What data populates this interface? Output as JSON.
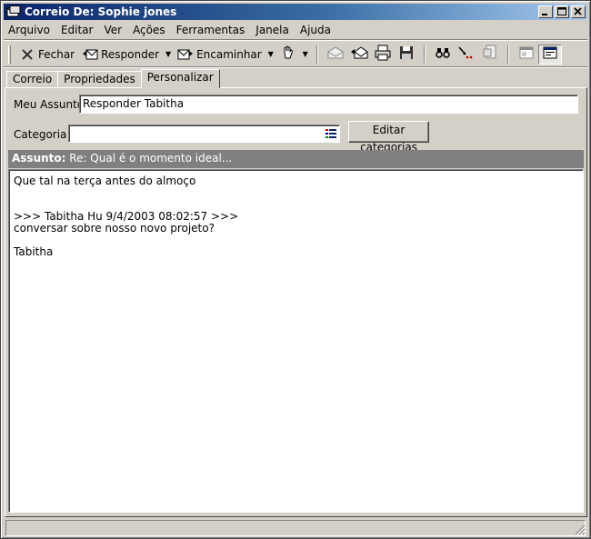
{
  "window": {
    "title": "Correio De: Sophie jones"
  },
  "menu": [
    "Arquivo",
    "Editar",
    "Ver",
    "Ações",
    "Ferramentas",
    "Janela",
    "Ajuda"
  ],
  "toolbar": {
    "close_label": "Fechar",
    "reply_label": "Responder",
    "forward_label": "Encaminhar"
  },
  "tabs": [
    {
      "label": "Correio",
      "active": false
    },
    {
      "label": "Propriedades",
      "active": false
    },
    {
      "label": "Personalizar",
      "active": true
    }
  ],
  "form": {
    "my_subject_label": "Meu Assunto:",
    "my_subject_value": "Responder Tabitha",
    "category_label": "Categoria",
    "category_value": "",
    "edit_categories_label": "Editar categorias"
  },
  "message": {
    "subject_prefix": "Assunto:",
    "subject_value": "Re: Qual é o momento ideal...",
    "body_lines": [
      "Que tal na terça antes do almoço",
      "",
      "",
      ">>> Tabitha Hu 9/4/2003 08:02:57 >>>",
      "conversar sobre nosso novo projeto?",
      "",
      "Tabitha"
    ]
  },
  "icons": {
    "app": "mail-window-icon",
    "close": "x-icon",
    "reply": "reply-icon",
    "forward": "forward-icon",
    "category_picker": "list-icon"
  },
  "colors": {
    "title_start": "#0a246a",
    "title_end": "#a6caf0",
    "face": "#d4d0c8",
    "subject_bar": "#808080"
  }
}
